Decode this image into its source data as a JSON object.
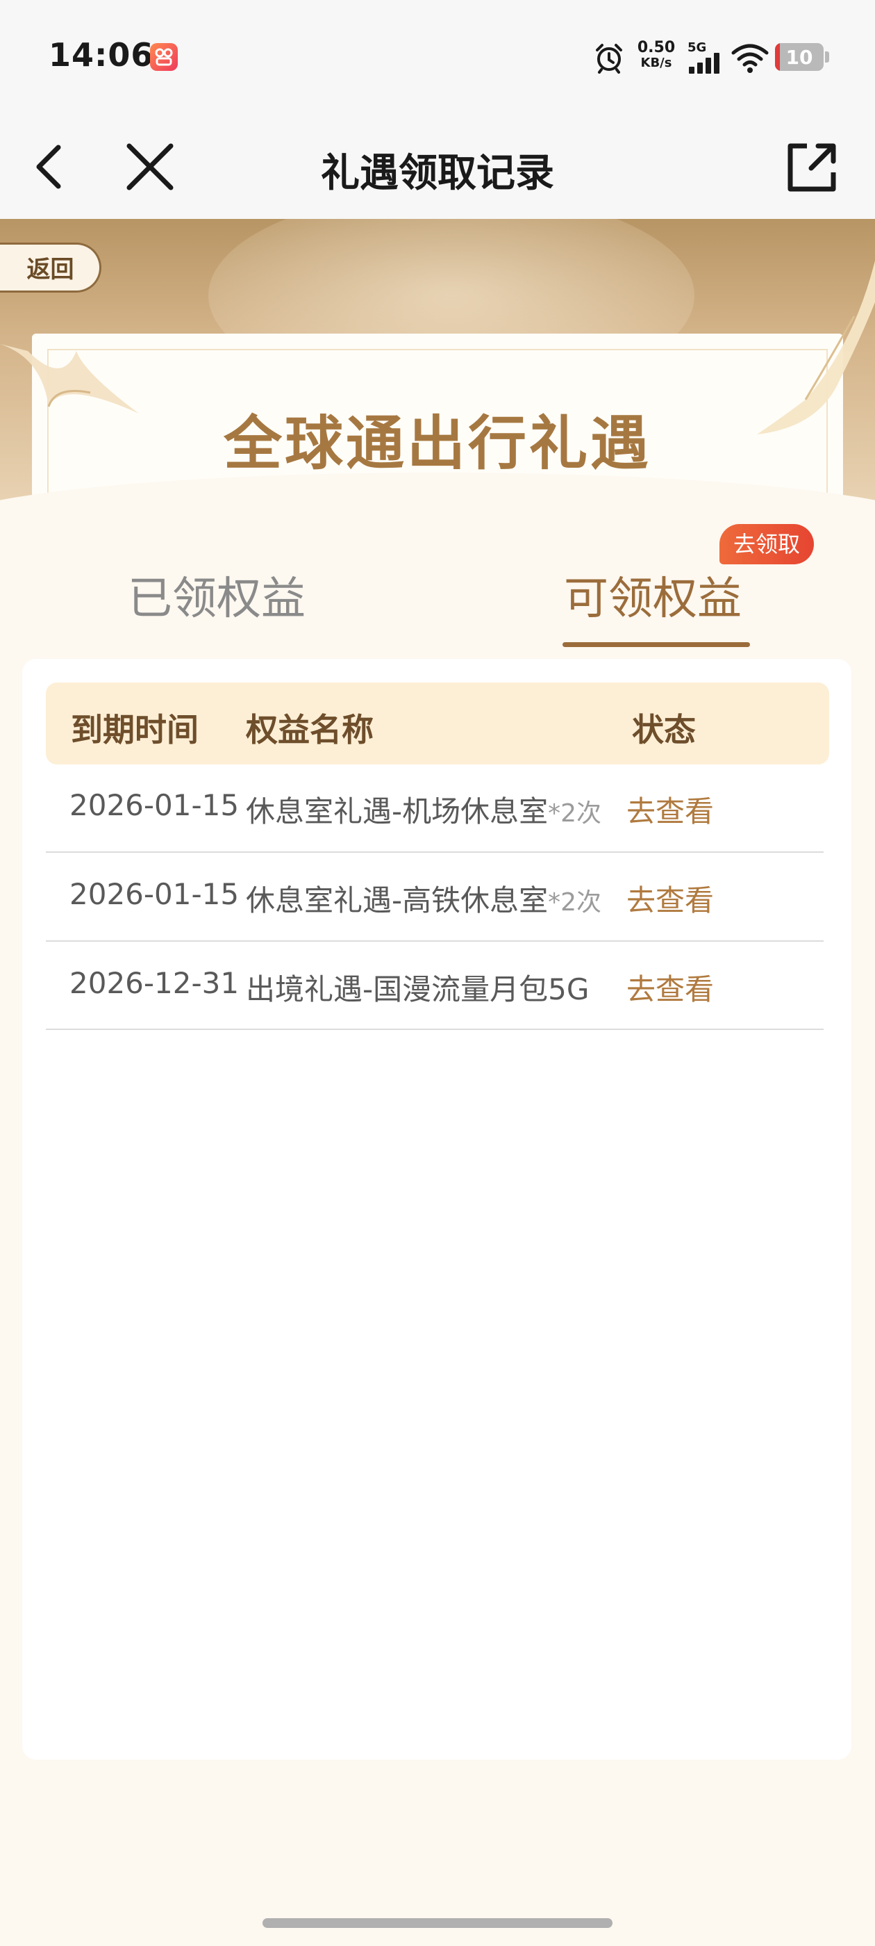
{
  "status_bar": {
    "time": "14:06",
    "net_speed_value": "0.50",
    "net_speed_unit": "KB/s",
    "signal_label": "5G",
    "battery_level": "10",
    "battery_fraction": 0.1
  },
  "nav": {
    "title": "礼遇领取记录"
  },
  "banner": {
    "return_label": "返回",
    "title": "全球通出行礼遇"
  },
  "tabs": {
    "claimed": "已领权益",
    "available": "可领权益",
    "claim_badge": "去领取"
  },
  "table": {
    "headers": {
      "expiry": "到期时间",
      "name": "权益名称",
      "status": "状态"
    },
    "rows": [
      {
        "expiry": "2026-01-15",
        "name": "休息室礼遇-机场休息室",
        "times": "*2次",
        "action": "去查看"
      },
      {
        "expiry": "2026-01-15",
        "name": "休息室礼遇-高铁休息室",
        "times": "*2次",
        "action": "去查看"
      },
      {
        "expiry": "2026-12-31",
        "name": "出境礼遇-国漫流量月包5G",
        "times": "",
        "action": "去查看"
      }
    ]
  },
  "colors": {
    "accent": "#9b6d3b",
    "action_text": "#b07a3f",
    "header_bg": "#fdefd6",
    "page_bg": "#fdf8f0",
    "badge_red": "#e64531"
  }
}
